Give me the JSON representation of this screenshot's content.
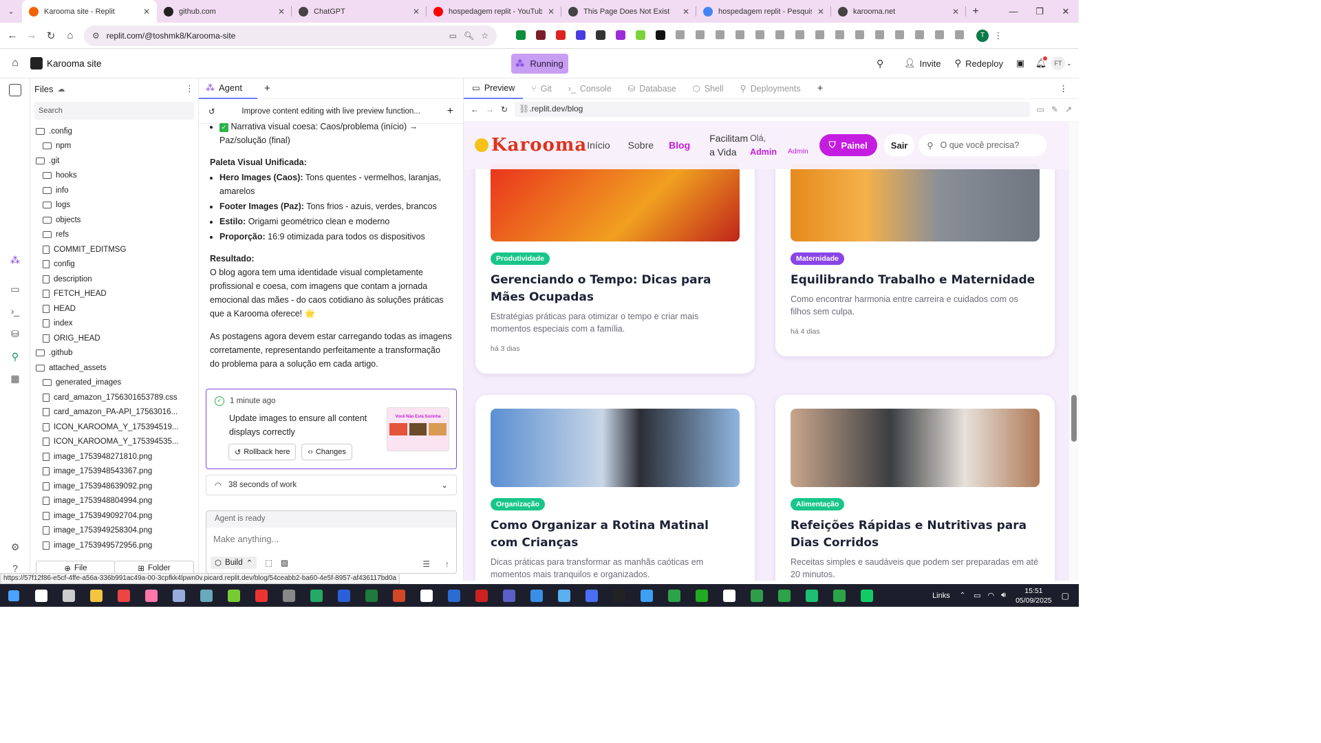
{
  "browser": {
    "tabs": [
      {
        "title": "Karooma site - Replit",
        "color": "#f26207",
        "active": true
      },
      {
        "title": "github.com",
        "color": "#222222"
      },
      {
        "title": "ChatGPT",
        "color": "#444444"
      },
      {
        "title": "hospedagem replit - YouTube",
        "color": "#ff0000"
      },
      {
        "title": "This Page Does Not Exist",
        "color": "#444444"
      },
      {
        "title": "hospedagem replit - Pesquisa G",
        "color": "#4285f4"
      },
      {
        "title": "karooma.net",
        "color": "#444444"
      }
    ],
    "url": "replit.com/@toshmk8/Karooma-site",
    "profile_initial": "T"
  },
  "replit": {
    "project_name": "Karooma site",
    "status": "Running",
    "invite_label": "Invite",
    "redeploy_label": "Redeploy",
    "avatar_initials": "FT"
  },
  "files": {
    "title": "Files",
    "search_placeholder": "Search",
    "items": [
      {
        "name": ".config",
        "type": "folder",
        "level": 0
      },
      {
        "name": "npm",
        "type": "folder",
        "level": 1
      },
      {
        "name": ".git",
        "type": "folder",
        "level": 0
      },
      {
        "name": "hooks",
        "type": "folder",
        "level": 1
      },
      {
        "name": "info",
        "type": "folder",
        "level": 1
      },
      {
        "name": "logs",
        "type": "folder",
        "level": 1
      },
      {
        "name": "objects",
        "type": "folder",
        "level": 1
      },
      {
        "name": "refs",
        "type": "folder",
        "level": 1
      },
      {
        "name": "COMMIT_EDITMSG",
        "type": "file",
        "level": 1
      },
      {
        "name": "config",
        "type": "file",
        "level": 1
      },
      {
        "name": "description",
        "type": "file",
        "level": 1
      },
      {
        "name": "FETCH_HEAD",
        "type": "file",
        "level": 1
      },
      {
        "name": "HEAD",
        "type": "file",
        "level": 1
      },
      {
        "name": "index",
        "type": "file",
        "level": 1
      },
      {
        "name": "ORIG_HEAD",
        "type": "file",
        "level": 1
      },
      {
        "name": ".github",
        "type": "folder",
        "level": 0
      },
      {
        "name": "attached_assets",
        "type": "folder",
        "level": 0
      },
      {
        "name": "generated_images",
        "type": "folder",
        "level": 1
      },
      {
        "name": "card_amazon_1756301653789.css",
        "type": "file",
        "level": 1
      },
      {
        "name": "card_amazon_PA-API_17563016...",
        "type": "file",
        "level": 1
      },
      {
        "name": "ICON_KAROOMA_Y_175394519...",
        "type": "file",
        "level": 1
      },
      {
        "name": "ICON_KAROOMA_Y_175394535...",
        "type": "file",
        "level": 1
      },
      {
        "name": "image_1753948271810.png",
        "type": "file",
        "level": 1
      },
      {
        "name": "image_1753948543367.png",
        "type": "file",
        "level": 1
      },
      {
        "name": "image_1753948639092.png",
        "type": "file",
        "level": 1
      },
      {
        "name": "image_1753948804994.png",
        "type": "file",
        "level": 1
      },
      {
        "name": "image_1753949092704.png",
        "type": "file",
        "level": 1
      },
      {
        "name": "image_1753949258304.png",
        "type": "file",
        "level": 1
      },
      {
        "name": "image_1753949572956.png",
        "type": "file",
        "level": 1
      }
    ],
    "new_file_label": "File",
    "new_folder_label": "Folder"
  },
  "agent": {
    "tab_label": "Agent",
    "thread_title": "Improve content editing with live preview function...",
    "top_line": "Narrativa visual coesa: Caos/problema (início) → Paz/solução (final)",
    "palette_heading": "Paleta Visual Unificada:",
    "palette_items": [
      {
        "label": "Hero Images (Caos):",
        "text": "Tons quentes - vermelhos, laranjas, amarelos"
      },
      {
        "label": "Footer Images (Paz):",
        "text": "Tons frios - azuis, verdes, brancos"
      },
      {
        "label": "Estilo:",
        "text": "Origami geométrico clean e moderno"
      },
      {
        "label": "Proporção:",
        "text": "16:9 otimizada para todos os dispositivos"
      }
    ],
    "result_heading": "Resultado:",
    "result_text": "O blog agora tem uma identidade visual completamente profissional e coesa, com imagens que contam a jornada emocional das mães - do caos cotidiano às soluções práticas que a Karooma oferece! 🌟",
    "result_text2": "As postagens agora devem estar carregando todas as imagens corretamente, representando perfeitamente a transformação do problema para a solução em cada artigo.",
    "checkpoint_time": "1 minute ago",
    "checkpoint_text": "Update images to ensure all content displays correctly",
    "rollback_label": "Rollback here",
    "changes_label": "Changes",
    "thumb_text": "Você Não Está Sozinha",
    "work_label": "38 seconds of work",
    "status": "Agent is ready",
    "input_placeholder": "Make anything...",
    "build_label": "Build"
  },
  "preview": {
    "tabs": [
      "Preview",
      "Git",
      "Console",
      "Database",
      "Shell",
      "Deployments"
    ],
    "url": ".replit.dev/blog",
    "site": {
      "logo": "Karooma",
      "nav": [
        "Início",
        "Sobre",
        "Blog"
      ],
      "tagline_line1": "Facilitam",
      "tagline_line2": "a Vida",
      "greeting": "Olá,",
      "user": "Admin",
      "role": "Admin",
      "panel_label": "Painel",
      "logout_label": "Sair",
      "search_placeholder": "O que você precisa?",
      "brand_color": "#c41de0",
      "posts": [
        {
          "tag": "Produtividade",
          "tag_color": "#19c68a",
          "title": "Gerenciando o Tempo: Dicas para Mães Ocupadas",
          "desc": "Estratégias práticas para otimizar o tempo e criar mais momentos especiais com a família.",
          "meta": "há 3 dias"
        },
        {
          "tag": "Maternidade",
          "tag_color": "#8a45e6",
          "title": "Equilibrando Trabalho e Maternidade",
          "desc": "Como encontrar harmonia entre carreira e cuidados com os filhos sem culpa.",
          "meta": "há 4 dias"
        },
        {
          "tag": "Organização",
          "tag_color": "#19c68a",
          "title": "Como Organizar a Rotina Matinal com Crianças",
          "desc": "Dicas práticas para transformar as manhãs caóticas em momentos mais tranquilos e organizados.",
          "meta": ""
        },
        {
          "tag": "Alimentação",
          "tag_color": "#19c68a",
          "title": "Refeições Rápidas e Nutritivas para Dias Corridos",
          "desc": "Receitas simples e saudáveis que podem ser preparadas em até 20 minutos.",
          "meta": ""
        }
      ]
    }
  },
  "status_url": "https://57f12f86-e5cf-4ffe-a56a-336b991ac49a-00-3cpfkk4lpwn0v.picard.replit.dev/blog/54ceabb2-ba60-4e5f-8957-af436117bd0a",
  "taskbar": {
    "links_label": "Links",
    "time": "15:51",
    "date": "05/09/2025"
  }
}
